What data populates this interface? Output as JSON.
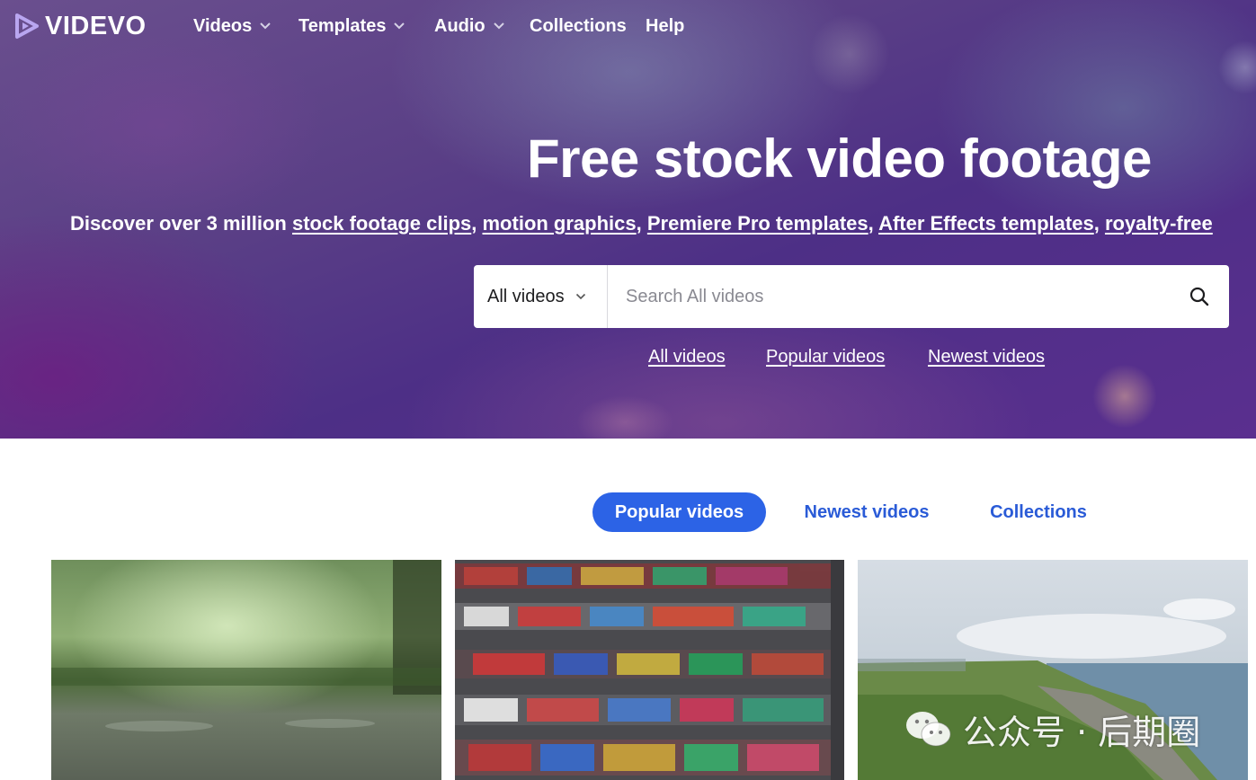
{
  "brand": {
    "logo_text": "VIDEVO"
  },
  "nav": {
    "items": [
      {
        "label": "Videos",
        "has_dropdown": true
      },
      {
        "label": "Templates",
        "has_dropdown": true
      },
      {
        "label": "Audio",
        "has_dropdown": true
      },
      {
        "label": "Collections",
        "has_dropdown": false
      },
      {
        "label": "Help",
        "has_dropdown": false
      }
    ]
  },
  "hero": {
    "title": "Free stock video footage",
    "subtitle_prefix": "Discover over 3 million ",
    "subtitle_links": [
      "stock footage clips",
      "motion graphics",
      "Premiere Pro templates",
      "After Effects templates",
      "royalty-free"
    ],
    "separator": ", "
  },
  "search": {
    "category_selected": "All videos",
    "placeholder": "Search All videos",
    "value": ""
  },
  "quick_links": [
    "All videos",
    "Popular videos",
    "Newest videos"
  ],
  "tabs": [
    {
      "label": "Popular videos",
      "active": true
    },
    {
      "label": "Newest videos",
      "active": false
    },
    {
      "label": "Collections",
      "active": false
    }
  ],
  "watermark": {
    "text": "公众号 · 后期圈"
  },
  "colors": {
    "accent": "#2c63e6",
    "link": "#2a5bd7",
    "hero_purple": "#5a3f86",
    "white": "#ffffff"
  },
  "icons": {
    "logo": "play-triangle-icon",
    "dropdown": "chevron-down-icon",
    "search": "search-icon",
    "watermark": "wechat-icon"
  }
}
